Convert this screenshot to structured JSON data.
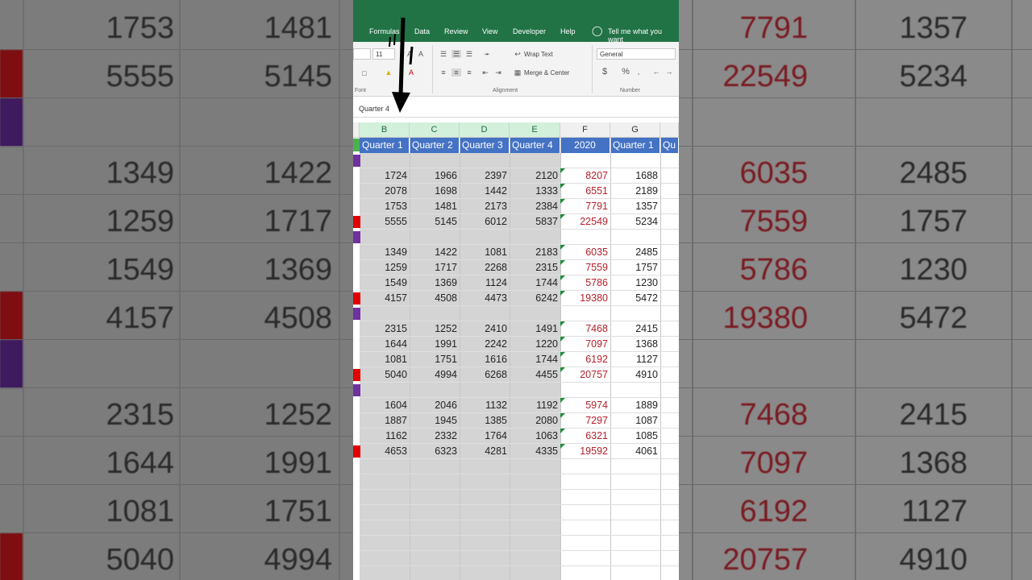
{
  "ribbon": {
    "tabs": [
      "Formulas",
      "Data",
      "Review",
      "View",
      "Developer",
      "Help"
    ],
    "tell_me": "Tell me what you want",
    "font_size": "11",
    "wrap_text": "Wrap Text",
    "merge_center": "Merge & Center",
    "number_format": "General",
    "group_font": "Font",
    "group_alignment": "Alignment",
    "group_number": "Number",
    "currency_symbol": "$",
    "percent_symbol": "%"
  },
  "name_box": "Quarter 4",
  "columns": [
    "B",
    "C",
    "D",
    "E",
    "F",
    "G"
  ],
  "headers": [
    "Quarter 1",
    "Quarter 2",
    "Quarter 3",
    "Quarter 4",
    "2020",
    "Quarter 1",
    "Qu"
  ],
  "rows": [
    {
      "b": "",
      "c": "",
      "d": "",
      "e": "",
      "f": "",
      "g": "",
      "strip": "purple"
    },
    {
      "b": "1724",
      "c": "1966",
      "d": "2397",
      "e": "2120",
      "f": "8207",
      "g": "1688"
    },
    {
      "b": "2078",
      "c": "1698",
      "d": "1442",
      "e": "1333",
      "f": "6551",
      "g": "2189"
    },
    {
      "b": "1753",
      "c": "1481",
      "d": "2173",
      "e": "2384",
      "f": "7791",
      "g": "1357"
    },
    {
      "b": "5555",
      "c": "5145",
      "d": "6012",
      "e": "5837",
      "f": "22549",
      "g": "5234",
      "strip": "red"
    },
    {
      "b": "",
      "c": "",
      "d": "",
      "e": "",
      "f": "",
      "g": "",
      "strip": "purple"
    },
    {
      "b": "1349",
      "c": "1422",
      "d": "1081",
      "e": "2183",
      "f": "6035",
      "g": "2485"
    },
    {
      "b": "1259",
      "c": "1717",
      "d": "2268",
      "e": "2315",
      "f": "7559",
      "g": "1757"
    },
    {
      "b": "1549",
      "c": "1369",
      "d": "1124",
      "e": "1744",
      "f": "5786",
      "g": "1230"
    },
    {
      "b": "4157",
      "c": "4508",
      "d": "4473",
      "e": "6242",
      "f": "19380",
      "g": "5472",
      "strip": "red"
    },
    {
      "b": "",
      "c": "",
      "d": "",
      "e": "",
      "f": "",
      "g": "",
      "strip": "purple"
    },
    {
      "b": "2315",
      "c": "1252",
      "d": "2410",
      "e": "1491",
      "f": "7468",
      "g": "2415"
    },
    {
      "b": "1644",
      "c": "1991",
      "d": "2242",
      "e": "1220",
      "f": "7097",
      "g": "1368"
    },
    {
      "b": "1081",
      "c": "1751",
      "d": "1616",
      "e": "1744",
      "f": "6192",
      "g": "1127"
    },
    {
      "b": "5040",
      "c": "4994",
      "d": "6268",
      "e": "4455",
      "f": "20757",
      "g": "4910",
      "strip": "red"
    },
    {
      "b": "",
      "c": "",
      "d": "",
      "e": "",
      "f": "",
      "g": "",
      "strip": "purple"
    },
    {
      "b": "1604",
      "c": "2046",
      "d": "1132",
      "e": "1192",
      "f": "5974",
      "g": "1889"
    },
    {
      "b": "1887",
      "c": "1945",
      "d": "1385",
      "e": "2080",
      "f": "7297",
      "g": "1087"
    },
    {
      "b": "1162",
      "c": "2332",
      "d": "1764",
      "e": "1063",
      "f": "6321",
      "g": "1085"
    },
    {
      "b": "4653",
      "c": "6323",
      "d": "4281",
      "e": "4335",
      "f": "19592",
      "g": "4061",
      "strip": "red"
    }
  ],
  "backdrop_left": [
    {
      "a": "1753",
      "b": "1481",
      "stripe": ""
    },
    {
      "a": "5555",
      "b": "5145",
      "stripe": "red"
    },
    {
      "a": "",
      "b": "",
      "stripe": "purple"
    },
    {
      "a": "1349",
      "b": "1422",
      "stripe": ""
    },
    {
      "a": "1259",
      "b": "1717",
      "stripe": ""
    },
    {
      "a": "1549",
      "b": "1369",
      "stripe": ""
    },
    {
      "a": "4157",
      "b": "4508",
      "stripe": "red"
    },
    {
      "a": "",
      "b": "",
      "stripe": "purple"
    },
    {
      "a": "2315",
      "b": "1252",
      "stripe": ""
    },
    {
      "a": "1644",
      "b": "1991",
      "stripe": ""
    },
    {
      "a": "1081",
      "b": "1751",
      "stripe": ""
    },
    {
      "a": "5040",
      "b": "4994",
      "stripe": "red"
    }
  ],
  "backdrop_right": [
    {
      "a": "7791",
      "b": "1357"
    },
    {
      "a": "22549",
      "b": "5234"
    },
    {
      "a": "",
      "b": ""
    },
    {
      "a": "6035",
      "b": "2485"
    },
    {
      "a": "7559",
      "b": "1757"
    },
    {
      "a": "5786",
      "b": "1230"
    },
    {
      "a": "19380",
      "b": "5472"
    },
    {
      "a": "",
      "b": ""
    },
    {
      "a": "7468",
      "b": "2415"
    },
    {
      "a": "7097",
      "b": "1368"
    },
    {
      "a": "6192",
      "b": "1127"
    },
    {
      "a": "20757",
      "b": "4910"
    }
  ],
  "colors": {
    "excel_green": "#217346",
    "header_blue": "#4472c4",
    "total_red": "#b4202a",
    "strip_red": "#e00000",
    "strip_purple": "#7030a0"
  }
}
